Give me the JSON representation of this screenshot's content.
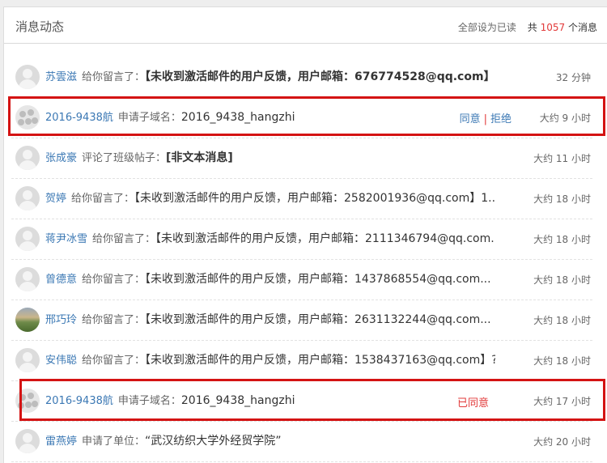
{
  "header": {
    "title": "消息动态",
    "mark_all_read": "全部设为已读",
    "total_prefix": "共",
    "total_count": "1057",
    "total_suffix": "个消息"
  },
  "messages": [
    {
      "user": "苏雲滋",
      "action": "给你留言了：",
      "text": "【未收到激活邮件的用户反馈，用户邮箱：676774528@qq.com】...",
      "time": "32 分钟",
      "avatar": "default-avatar-icon",
      "bold": true
    },
    {
      "user": "2016-9438航",
      "action": "申请子域名：",
      "text": "2016_9438_hangzhi",
      "time": "大约 9 小时",
      "avatar": "group-avatar-icon",
      "agree": "同意",
      "sep": "|",
      "reject": "拒绝"
    },
    {
      "user": "张成豪",
      "action": "评论了班级帖子：",
      "text": "[非文本消息]",
      "time": "大约 11 小时",
      "avatar": "default-avatar-icon",
      "bold": true
    },
    {
      "user": "贺婷",
      "action": "给你留言了：",
      "text": "【未收到激活邮件的用户反馈，用户邮箱：2582001936@qq.com】1...",
      "time": "大约 18 小时",
      "avatar": "default-avatar-icon"
    },
    {
      "user": "蒋尹冰雪",
      "action": "给你留言了：",
      "text": "【未收到激活邮件的用户反馈，用户邮箱：2111346794@qq.com...",
      "time": "大约 18 小时",
      "avatar": "default-avatar-icon"
    },
    {
      "user": "曾德意",
      "action": "给你留言了：",
      "text": "【未收到激活邮件的用户反馈，用户邮箱：1437868554@qq.com...",
      "time": "大约 18 小时",
      "avatar": "default-avatar-icon"
    },
    {
      "user": "邢巧玲",
      "action": "给你留言了：",
      "text": "【未收到激活邮件的用户反馈，用户邮箱：2631132244@qq.com...",
      "time": "大约 18 小时",
      "avatar": "photo-avatar-icon"
    },
    {
      "user": "安伟聪",
      "action": "给你留言了：",
      "text": "【未收到激活邮件的用户反馈，用户邮箱：1538437163@qq.com】?",
      "time": "大约 18 小时",
      "avatar": "default-avatar-icon"
    },
    {
      "user": "2016-9438航",
      "action": "申请子域名：",
      "text": "2016_9438_hangzhi",
      "time": "大约 17 小时",
      "avatar": "group-avatar-icon",
      "status": "已同意"
    },
    {
      "user": "雷燕婷",
      "action": "申请了单位：",
      "text": "“武汉纺织大学外经贸学院”",
      "time": "大约 20 小时",
      "avatar": "default-avatar-icon"
    }
  ],
  "colors": {
    "link": "#3b78b4",
    "count": "#e23a3a",
    "highlight": "#d41313"
  }
}
